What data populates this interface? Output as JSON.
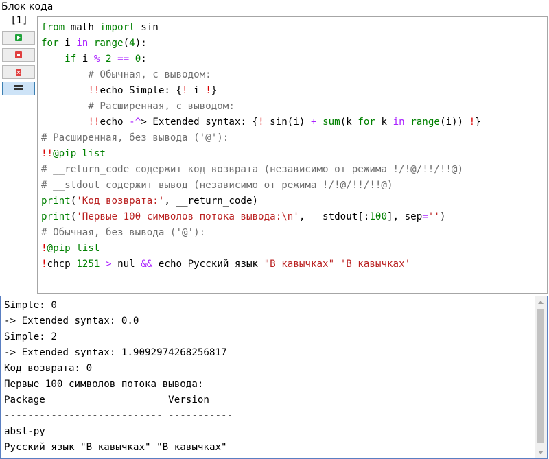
{
  "window": {
    "block_title": "Блок кода"
  },
  "cell": {
    "number": "[1]",
    "buttons": [
      {
        "name": "run",
        "icon": "run-icon"
      },
      {
        "name": "stop",
        "icon": "stop-icon"
      },
      {
        "name": "clear",
        "icon": "clear-output-icon"
      },
      {
        "name": "toggle-output",
        "icon": "list-lines-icon"
      }
    ]
  },
  "code_lines": [
    [
      [
        "kw",
        "from"
      ],
      [
        "pl",
        " math "
      ],
      [
        "kw",
        "import"
      ],
      [
        "pl",
        " sin"
      ]
    ],
    [
      [
        "kw",
        "for"
      ],
      [
        "pl",
        " i "
      ],
      [
        "kw2",
        "in"
      ],
      [
        "pl",
        " "
      ],
      [
        "bi",
        "range"
      ],
      [
        "pl",
        "("
      ],
      [
        "num",
        "4"
      ],
      [
        "pl",
        "):"
      ]
    ],
    [
      [
        "pl",
        "    "
      ],
      [
        "kw",
        "if"
      ],
      [
        "pl",
        " i "
      ],
      [
        "op",
        "%"
      ],
      [
        "pl",
        " "
      ],
      [
        "num",
        "2"
      ],
      [
        "pl",
        " "
      ],
      [
        "op",
        "=="
      ],
      [
        "pl",
        " "
      ],
      [
        "num",
        "0"
      ],
      [
        "pl",
        ":"
      ]
    ],
    [
      [
        "pl",
        "        "
      ],
      [
        "cm",
        "# Обычная, с выводом:"
      ]
    ],
    [
      [
        "pl",
        "        "
      ],
      [
        "bang",
        "!!"
      ],
      [
        "pl",
        "echo Simple: {"
      ],
      [
        "bang",
        "!"
      ],
      [
        "pl",
        " i "
      ],
      [
        "bang",
        "!"
      ],
      [
        "pl",
        "}"
      ]
    ],
    [
      [
        "pl",
        "        "
      ],
      [
        "cm",
        "# Расширенная, с выводом:"
      ]
    ],
    [
      [
        "pl",
        "        "
      ],
      [
        "bang",
        "!!"
      ],
      [
        "pl",
        "echo "
      ],
      [
        "op",
        "-^"
      ],
      [
        "pl",
        "> Extended syntax: {"
      ],
      [
        "bang",
        "!"
      ],
      [
        "pl",
        " sin(i) "
      ],
      [
        "op",
        "+"
      ],
      [
        "pl",
        " "
      ],
      [
        "bi",
        "sum"
      ],
      [
        "pl",
        "(k "
      ],
      [
        "kw",
        "for"
      ],
      [
        "pl",
        " k "
      ],
      [
        "kw2",
        "in"
      ],
      [
        "pl",
        " "
      ],
      [
        "bi",
        "range"
      ],
      [
        "pl",
        "(i)) "
      ],
      [
        "bang",
        "!"
      ],
      [
        "pl",
        "}"
      ]
    ],
    [
      [
        "cm",
        "# Расширенная, без вывода ('@'):"
      ]
    ],
    [
      [
        "bang",
        "!!"
      ],
      [
        "kw",
        "@pip list"
      ]
    ],
    [
      [
        "cm",
        "# __return_code содержит код возврата (независимо от режима !/!@/!!/!!@)"
      ]
    ],
    [
      [
        "cm",
        "# __stdout содержит вывод (независимо от режима !/!@/!!/!!@)"
      ]
    ],
    [
      [
        "bi",
        "print"
      ],
      [
        "pl",
        "("
      ],
      [
        "str",
        "'Код возврата:'"
      ],
      [
        "pl",
        ", __return_code)"
      ]
    ],
    [
      [
        "bi",
        "print"
      ],
      [
        "pl",
        "("
      ],
      [
        "str",
        "'Первые 100 символов потока вывода:\\n'"
      ],
      [
        "pl",
        ", __stdout[:"
      ],
      [
        "num",
        "100"
      ],
      [
        "pl",
        "], sep"
      ],
      [
        "op",
        "="
      ],
      [
        "str",
        "''"
      ],
      [
        "pl",
        ")"
      ]
    ],
    [
      [
        "cm",
        "# Обычная, без вывода ('@'):"
      ]
    ],
    [
      [
        "bang",
        "!"
      ],
      [
        "kw",
        "@pip list"
      ]
    ],
    [
      [
        "bang",
        "!"
      ],
      [
        "pl",
        "chcp "
      ],
      [
        "num",
        "1251"
      ],
      [
        "pl",
        " "
      ],
      [
        "op",
        ">"
      ],
      [
        "pl",
        " nul "
      ],
      [
        "op",
        "&&"
      ],
      [
        "pl",
        " echo Русский язык "
      ],
      [
        "str",
        "\"В кавычках\""
      ],
      [
        "pl",
        " "
      ],
      [
        "str",
        "'В кавычках'"
      ]
    ]
  ],
  "output_lines": [
    "Simple: 0",
    "-> Extended syntax: 0.0",
    "Simple: 2",
    "-> Extended syntax: 1.9092974268256817",
    "Код возврата: 0",
    "Первые 100 символов потока вывода:",
    "Package                     Version",
    "--------------------------- -----------",
    "absl-py",
    "Русский язык \"В кавычках\" \"В кавычках\""
  ]
}
